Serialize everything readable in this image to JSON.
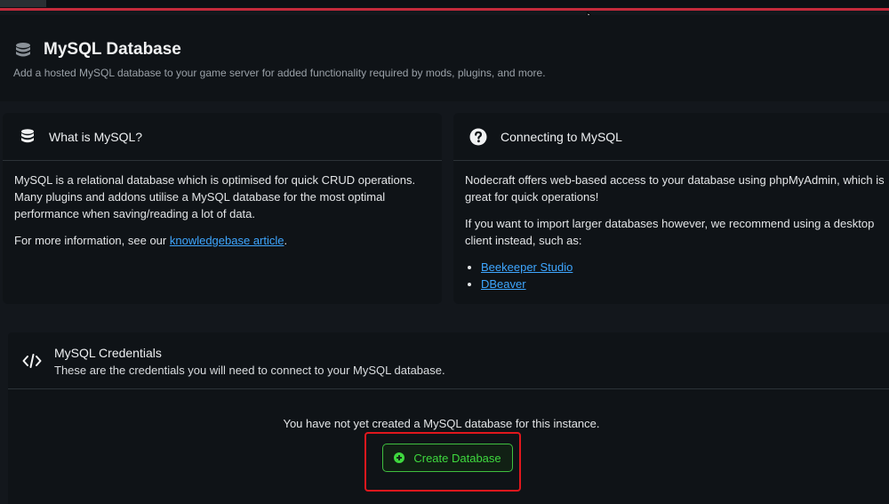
{
  "header": {
    "title": "MySQL Database",
    "subtitle": "Add a hosted MySQL database to your game server for added functionality required by mods, plugins, and more.",
    "icon": "database-icon"
  },
  "what_card": {
    "title": "What is MySQL?",
    "icon": "database-icon",
    "paragraph1": "MySQL is a relational database which is optimised for quick CRUD operations. Many plugins and addons utilise a MySQL database for the most optimal performance when saving/reading a lot of data.",
    "more_info_prefix": "For more information, see our ",
    "more_info_link": "knowledgebase article",
    "more_info_suffix": "."
  },
  "connect_card": {
    "title": "Connecting to MySQL",
    "icon": "question-circle-icon",
    "paragraph1": "Nodecraft offers web-based access to your database using phpMyAdmin, which is great for quick operations!",
    "paragraph2": "If you want to import larger databases however, we recommend using a desktop client instead, such as:",
    "clients": [
      "Beekeeper Studio",
      "DBeaver"
    ]
  },
  "credentials_card": {
    "title": "MySQL Credentials",
    "subtitle": "These are the credentials you will need to connect to your MySQL database.",
    "icon": "code-icon",
    "empty_message": "You have not yet created a MySQL database for this instance.",
    "create_button_label": "Create Database",
    "create_button_icon": "plus-circle-icon"
  },
  "colors": {
    "accent_bar": "#c42a3b",
    "link": "#3ea6ff",
    "button_green": "#3ed83e",
    "highlight_red": "#e0171d"
  }
}
